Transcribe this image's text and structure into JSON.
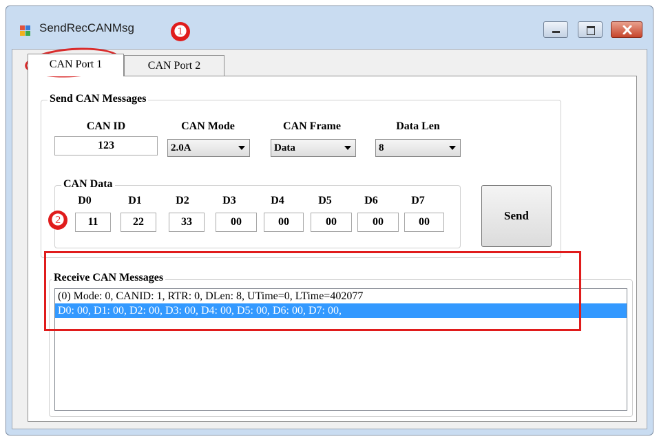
{
  "window": {
    "title": "SendRecCANMsg"
  },
  "tabs": [
    {
      "label": "CAN Port 1",
      "active": true
    },
    {
      "label": "CAN Port 2",
      "active": false
    }
  ],
  "send_group": {
    "title": "Send CAN Messages",
    "can_id": {
      "label": "CAN ID",
      "value": "123"
    },
    "can_mode": {
      "label": "CAN Mode",
      "value": "2.0A"
    },
    "can_frame": {
      "label": "CAN Frame",
      "value": "Data"
    },
    "data_len": {
      "label": "Data Len",
      "value": "8"
    },
    "can_data": {
      "title": "CAN Data",
      "fields": [
        {
          "label": "D0",
          "value": "11"
        },
        {
          "label": "D1",
          "value": "22"
        },
        {
          "label": "D2",
          "value": "33"
        },
        {
          "label": "D3",
          "value": "00"
        },
        {
          "label": "D4",
          "value": "00"
        },
        {
          "label": "D5",
          "value": "00"
        },
        {
          "label": "D6",
          "value": "00"
        },
        {
          "label": "D7",
          "value": "00"
        }
      ]
    },
    "send_label": "Send"
  },
  "receive_group": {
    "title": "Receive CAN Messages",
    "items": [
      {
        "text": "(0) Mode: 0, CANID: 1, RTR: 0, DLen: 8, UTime=0, LTime=402077",
        "selected": false
      },
      {
        "text": "D0: 00, D1: 00, D2: 00, D3: 00, D4: 00, D5: 00, D6: 00, D7: 00,",
        "selected": true
      }
    ]
  },
  "annotations": {
    "badge_1": "❶",
    "badge_2": "❷"
  },
  "colors": {
    "selection": "#3399ff",
    "annotation_red": "#e01c1c",
    "window_frame": "#c9dcf1"
  }
}
